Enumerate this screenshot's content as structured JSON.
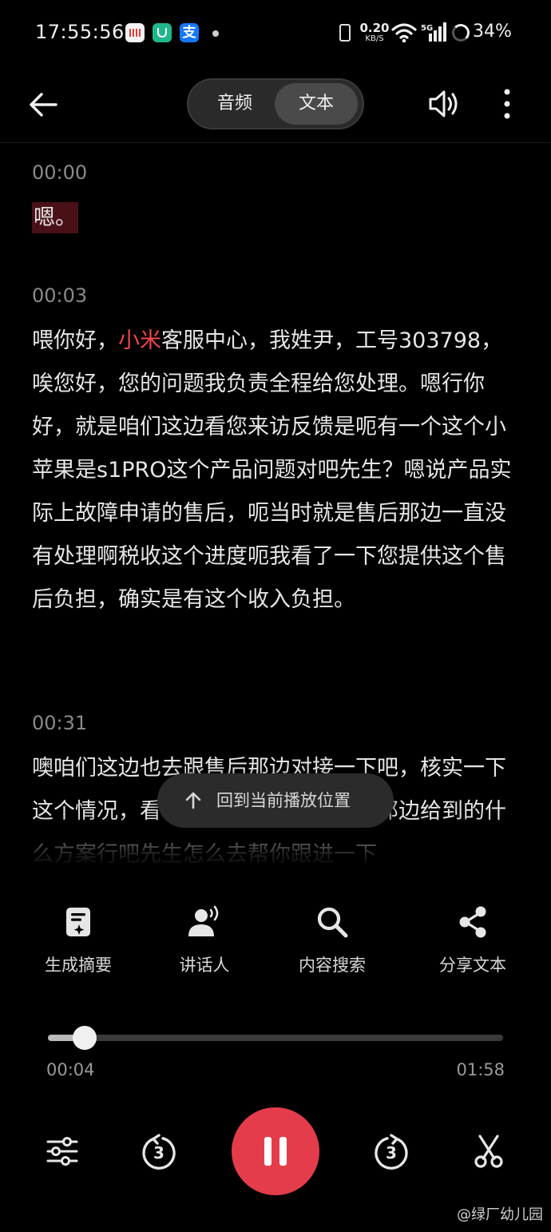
{
  "status_bar": {
    "time": "17:55:56",
    "net_speed_value": "0.20",
    "net_speed_unit": "KB/S",
    "signal_label": "5G",
    "battery": "34%"
  },
  "header": {
    "tabs": [
      {
        "label": "音频",
        "active": false
      },
      {
        "label": "文本",
        "active": true
      }
    ]
  },
  "transcript": [
    {
      "time": "00:00",
      "prefix": "嗯。",
      "highlight": "",
      "text": ""
    },
    {
      "time": "00:03",
      "prefix": "喂你好，",
      "highlight": "小米",
      "text": "客服中心，我姓尹，工号303798，唉您好，您的问题我负责全程给您处理。嗯行你好，就是咱们这边看您来访反馈是呃有一个这个小苹果是s1PRO这个产品问题对吧先生？嗯说产品实际上故障申请的售后，呃当时就是售后那边一直没有处理啊税收这个进度呃我看了一下您提供这个售后负担，确实是有这个收入负担。"
    },
    {
      "time": "00:31",
      "prefix": "",
      "highlight": "",
      "text": "噢咱们这边也去跟售后那边对接一下吧，核实一下这个情况，看一下是什么情况，他们那边给到的什么方案行吧先生怎么去帮你跟进一下"
    }
  ],
  "return_button": {
    "label": "回到当前播放位置"
  },
  "tools": [
    {
      "label": "生成摘要",
      "icon": "summary-icon"
    },
    {
      "label": "讲话人",
      "icon": "speaker-person-icon"
    },
    {
      "label": "内容搜索",
      "icon": "search-icon"
    },
    {
      "label": "分享文本",
      "icon": "share-icon"
    }
  ],
  "player": {
    "current_time": "00:04",
    "total_time": "01:58",
    "progress": 0.04,
    "skip_back_seconds": "3",
    "skip_forward_seconds": "3"
  },
  "watermark": "@绿厂幼儿园",
  "colors": {
    "accent": "#e43c4b",
    "highlight_text": "#f2454a",
    "highlight_bg": "#4a1018"
  }
}
